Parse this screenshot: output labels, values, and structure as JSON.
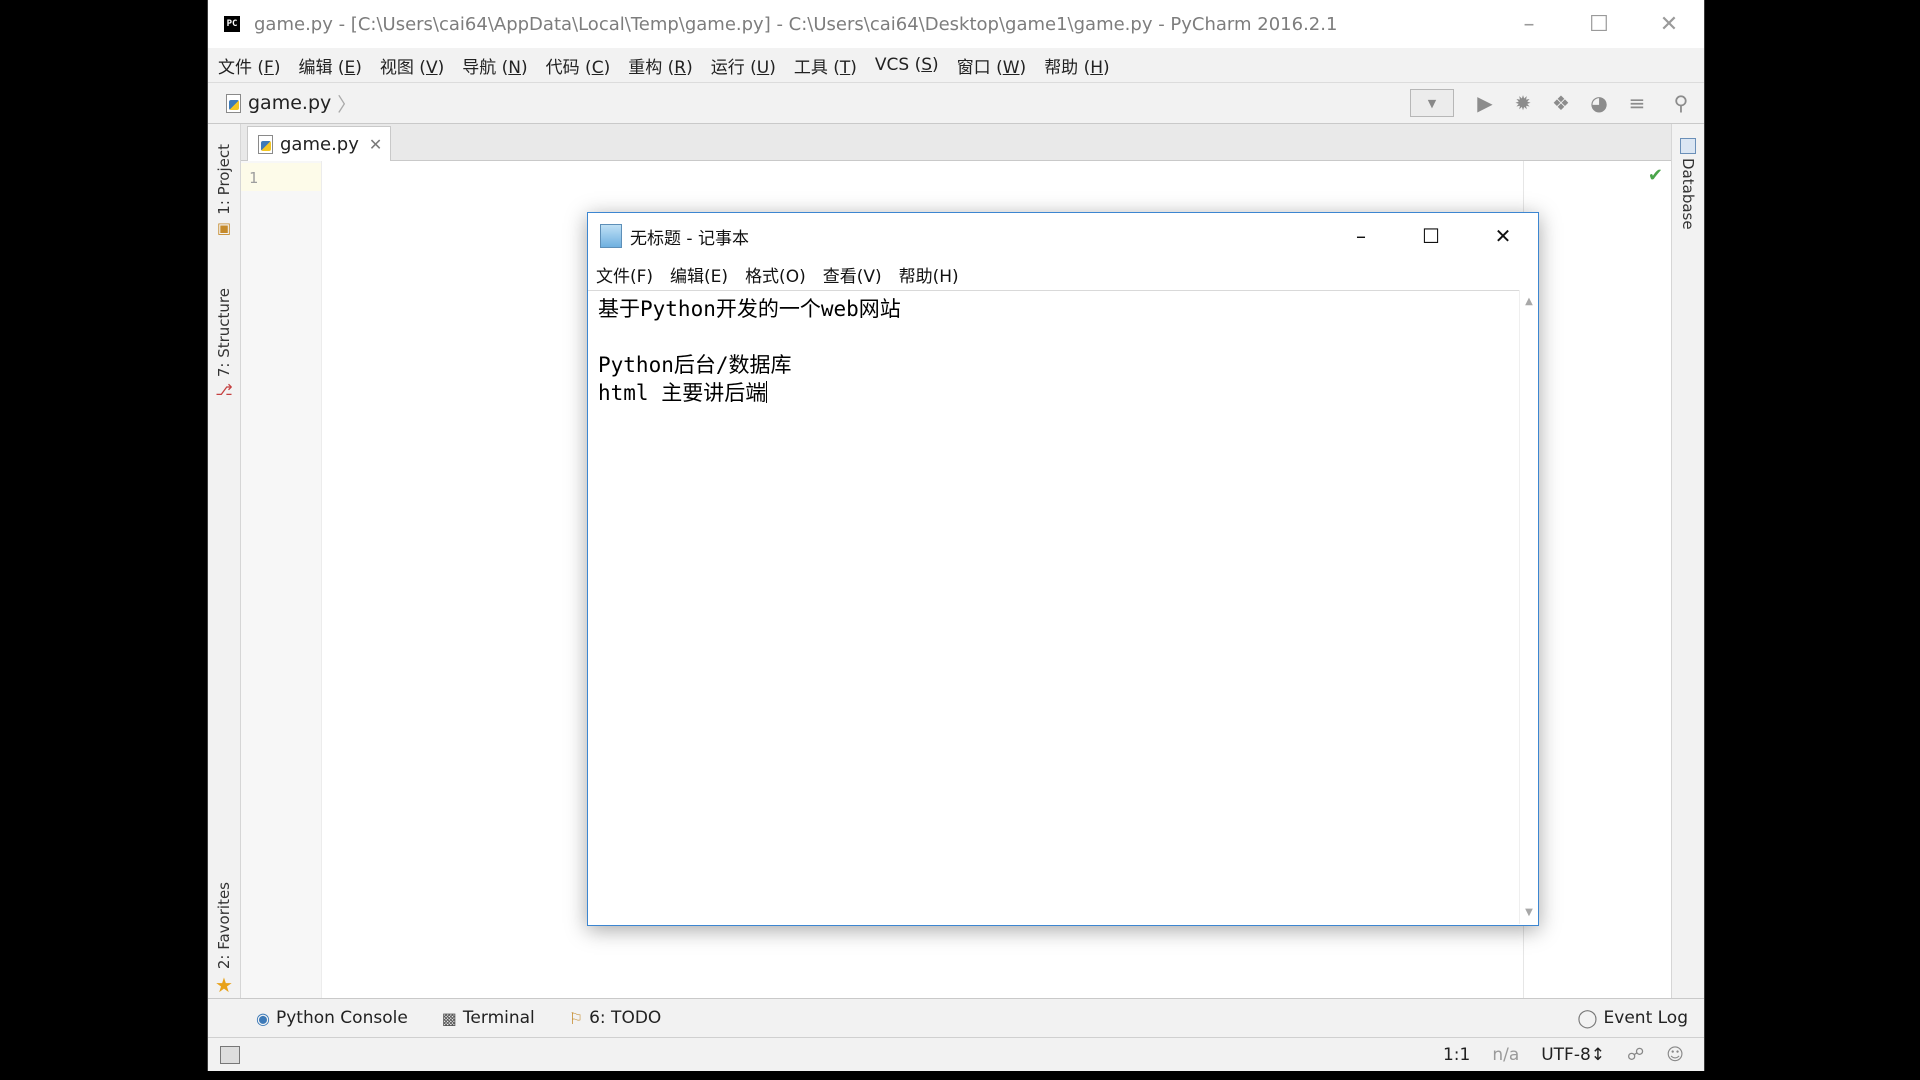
{
  "pycharm": {
    "title": "game.py - [C:\\Users\\cai64\\AppData\\Local\\Temp\\game.py] - C:\\Users\\cai64\\Desktop\\game1\\game.py - PyCharm 2016.2.1",
    "app_icon_text": "PC",
    "menu": [
      {
        "label": "文件 (",
        "key": "F",
        "end": ")"
      },
      {
        "label": "编辑 (",
        "key": "E",
        "end": ")"
      },
      {
        "label": "视图 (",
        "key": "V",
        "end": ")"
      },
      {
        "label": "导航 (",
        "key": "N",
        "end": ")"
      },
      {
        "label": "代码 (",
        "key": "C",
        "end": ")"
      },
      {
        "label": "重构 (",
        "key": "R",
        "end": ")"
      },
      {
        "label": "运行 (",
        "key": "U",
        "end": ")"
      },
      {
        "label": "工具 (",
        "key": "T",
        "end": ")"
      },
      {
        "label": "VCS (",
        "key": "S",
        "end": ")"
      },
      {
        "label": "窗口 (",
        "key": "W",
        "end": ")"
      },
      {
        "label": "帮助 (",
        "key": "H",
        "end": ")"
      }
    ],
    "breadcrumb": "game.py",
    "left_tabs": {
      "project": "1: Project",
      "structure": "7: Structure",
      "favorites": "2: Favorites"
    },
    "right_tabs": {
      "database": "Database"
    },
    "editor_tab": "game.py",
    "line_number": "1",
    "tool_buttons": {
      "python_console": "Python Console",
      "terminal": "Terminal",
      "todo": "6: TODO",
      "event_log": "Event Log"
    },
    "status": {
      "position": "1:1",
      "na": "n/a",
      "encoding": "UTF-8↕"
    }
  },
  "notepad": {
    "title": "无标题 - 记事本",
    "menu": [
      "文件(F)",
      "编辑(E)",
      "格式(O)",
      "查看(V)",
      "帮助(H)"
    ],
    "lines": [
      "基于Python开发的一个web网站",
      "",
      "Python后台/数据库",
      "html 主要讲后端"
    ]
  },
  "colors": {
    "accent": "#3c86d1",
    "check": "#4aa54a"
  },
  "icons": [
    "python-file-icon",
    "run-icon",
    "debug-icon",
    "coverage-icon",
    "profile-icon",
    "build-icon",
    "search-icon",
    "check-icon",
    "database-icon",
    "star-icon",
    "terminal-icon",
    "todo-icon",
    "event-log-icon",
    "lock-icon",
    "inspector-icon"
  ]
}
